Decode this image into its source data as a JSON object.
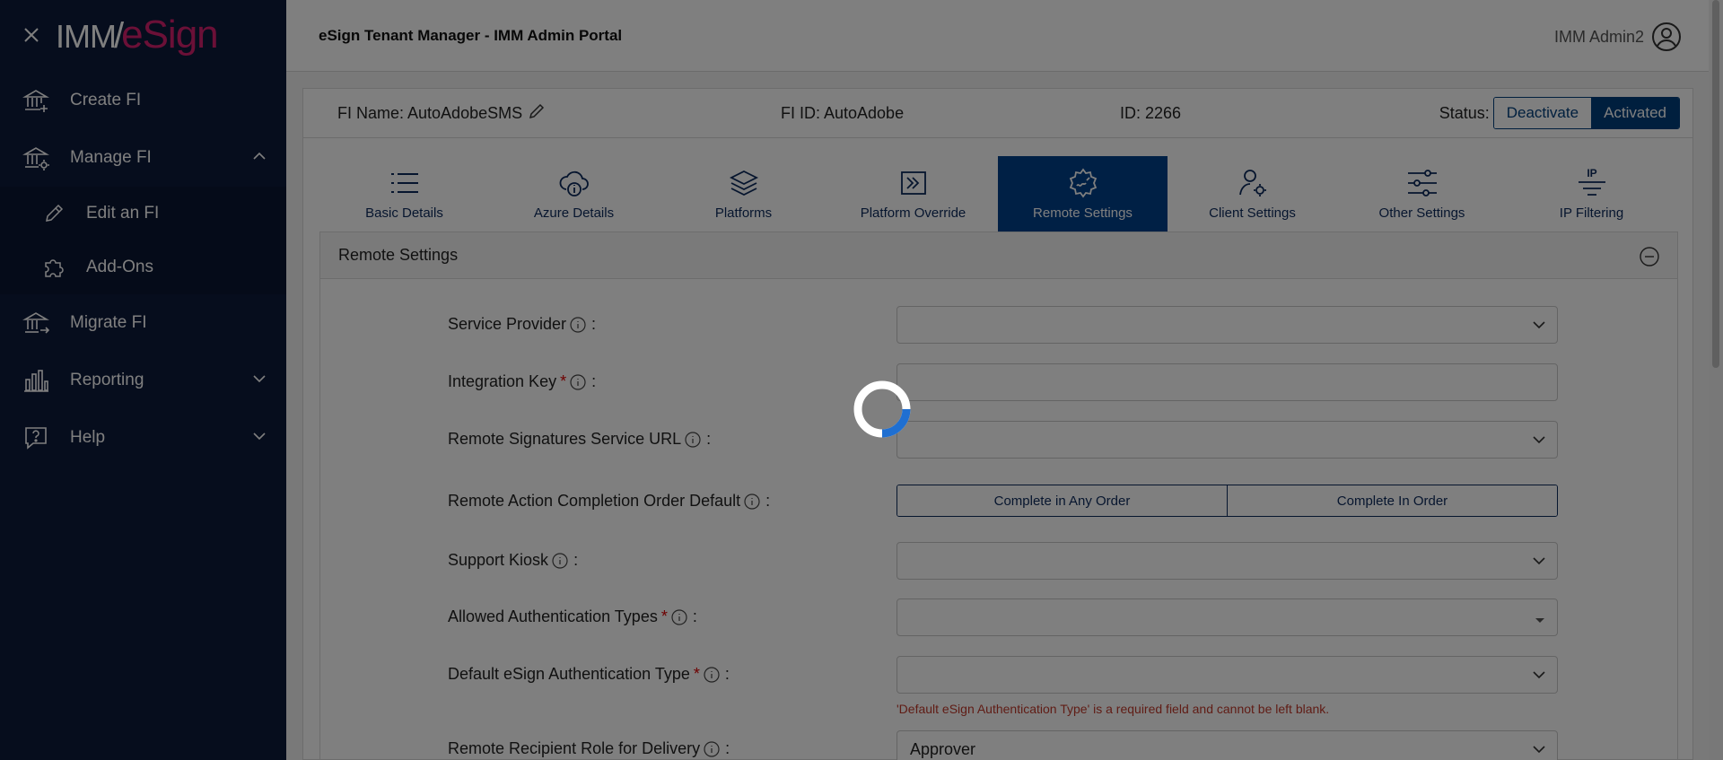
{
  "sidebar": {
    "logo": {
      "imm": "IMM",
      "esign": "eSign"
    },
    "items": [
      {
        "label": "Create FI",
        "icon": "bank-plus-icon"
      },
      {
        "label": "Manage FI",
        "icon": "bank-gear-icon"
      },
      {
        "label": "Migrate FI",
        "icon": "bank-arrow-icon"
      },
      {
        "label": "Reporting",
        "icon": "bar-chart-icon"
      },
      {
        "label": "Help",
        "icon": "help-bubble-icon"
      }
    ],
    "subitems": [
      {
        "label": "Edit an FI",
        "icon": "pencil-icon"
      },
      {
        "label": "Add-Ons",
        "icon": "puzzle-icon"
      }
    ]
  },
  "header": {
    "title": "eSign Tenant Manager - IMM Admin Portal",
    "user": "IMM Admin2"
  },
  "info": {
    "fi_name": "FI Name: AutoAdobeSMS",
    "fi_id": "FI ID: AutoAdobe",
    "id": "ID: 2266",
    "status_label": "Status:",
    "deactivate": "Deactivate",
    "activated": "Activated"
  },
  "tabs": [
    {
      "label": "Basic Details",
      "icon": "list-icon"
    },
    {
      "label": "Azure Details",
      "icon": "cloud-info-icon"
    },
    {
      "label": "Platforms",
      "icon": "layers-icon"
    },
    {
      "label": "Platform Override",
      "icon": "override-arrow-icon"
    },
    {
      "label": "Remote Settings",
      "icon": "remote-gear-icon",
      "active": true
    },
    {
      "label": "Client Settings",
      "icon": "user-gear-icon"
    },
    {
      "label": "Other Settings",
      "icon": "sliders-icon"
    },
    {
      "label": "IP Filtering",
      "icon": "ip-filter-icon"
    }
  ],
  "section": {
    "title": "Remote Settings",
    "fields": [
      {
        "label": "Service Provider",
        "required": false,
        "value": ""
      },
      {
        "label": "Integration Key",
        "required": true,
        "value": ""
      },
      {
        "label": "Remote Signatures Service URL",
        "required": false,
        "value": ""
      },
      {
        "label": "Remote Action Completion Order Default",
        "required": false,
        "options": [
          "Complete in Any Order",
          "Complete In Order"
        ]
      },
      {
        "label": "Support Kiosk",
        "required": false,
        "value": ""
      },
      {
        "label": "Allowed Authentication Types",
        "required": true,
        "value": ""
      },
      {
        "label": "Default eSign Authentication Type",
        "required": true,
        "value": "",
        "error": "'Default eSign Authentication Type' is a required field and cannot be left blank."
      },
      {
        "label": "Remote Recipient Role for Delivery",
        "required": false,
        "value": "Approver"
      }
    ],
    "colon": ":",
    "required_mark": "*"
  },
  "colors": {
    "sidebar_bg": "#0d1a3a",
    "accent": "#00408a",
    "brand_pink": "#d6206f",
    "error": "#c0392b"
  }
}
